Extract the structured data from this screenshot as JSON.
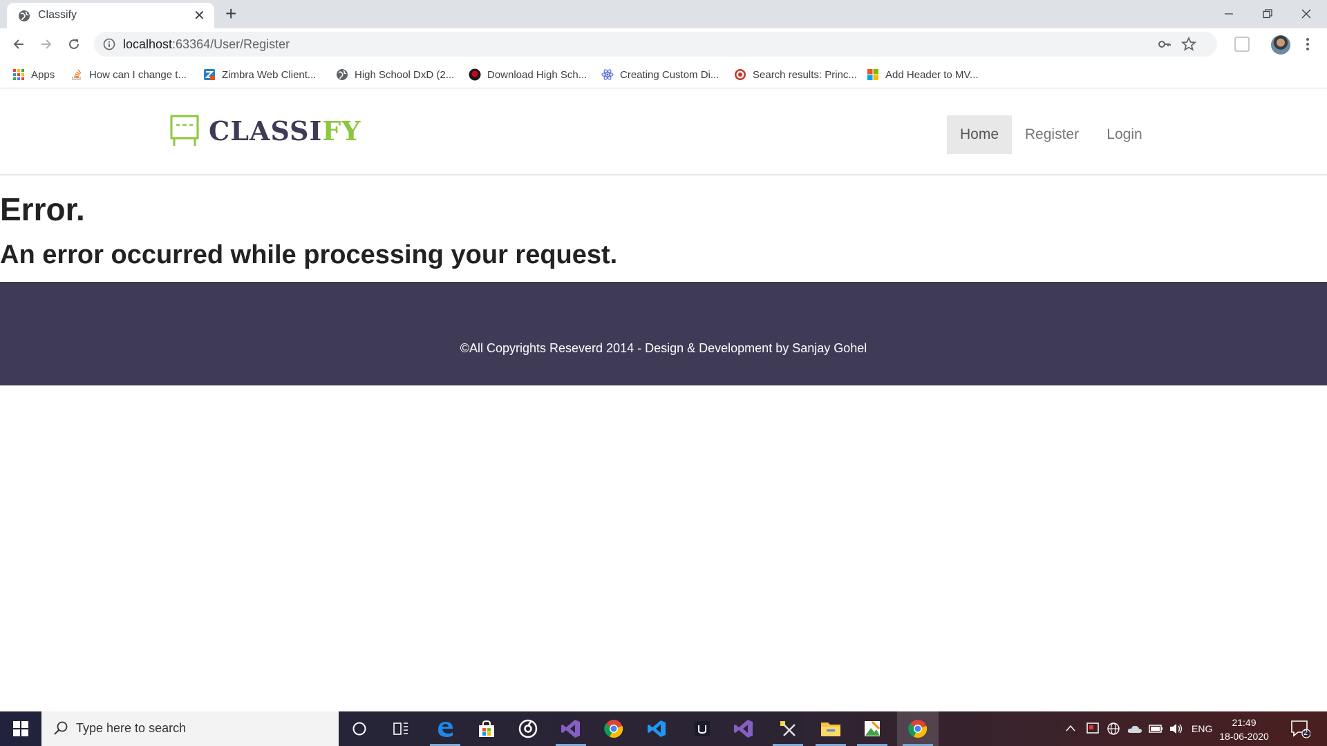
{
  "browser": {
    "tab_title": "Classify",
    "url_host": "localhost",
    "url_rest": ":63364/User/Register",
    "bookmarks": [
      {
        "label": "Apps",
        "icon": "apps-grid-icon"
      },
      {
        "label": "How can I change t...",
        "icon": "stackoverflow-icon"
      },
      {
        "label": "Zimbra Web Client...",
        "icon": "zimbra-icon"
      },
      {
        "label": "High School DxD (2...",
        "icon": "globe-icon"
      },
      {
        "label": "Download High Sch...",
        "icon": "anime-site-icon"
      },
      {
        "label": "Creating Custom Di...",
        "icon": "react-icon"
      },
      {
        "label": "Search results: Princ...",
        "icon": "target-icon"
      },
      {
        "label": "Add Header to MV...",
        "icon": "microsoft-icon"
      }
    ]
  },
  "site": {
    "logo_main": "CLASSI",
    "logo_accent": "FY",
    "nav": [
      {
        "label": "Home",
        "active": true
      },
      {
        "label": "Register",
        "active": false
      },
      {
        "label": "Login",
        "active": false
      }
    ],
    "error_title": "Error.",
    "error_message": "An error occurred while processing your request.",
    "footer_text": "©All Copyrights Reseverd 2014 - Design & Development by Sanjay Gohel"
  },
  "taskbar": {
    "search_placeholder": "Type here to search",
    "language": "ENG",
    "time": "21:49",
    "date": "18-06-2020",
    "notification_count": "2"
  },
  "colors": {
    "brand_dark": "#3f3b55",
    "brand_green": "#8dc63f",
    "footer_bg": "#3f3b57"
  }
}
